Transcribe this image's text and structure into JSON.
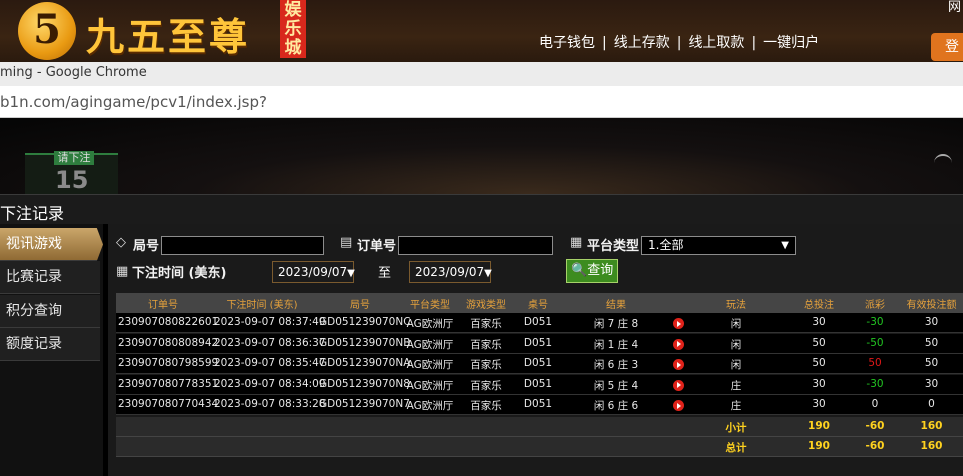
{
  "site": {
    "logo_digit": "5",
    "logo_text": "九五至尊",
    "logo_tag": "娱乐城",
    "nav": [
      "电子钱包",
      "线上存款",
      "线上取款",
      "一键归户"
    ],
    "top_right": "网",
    "action_button": "登"
  },
  "browser": {
    "window_title": "ming - Google Chrome",
    "url": "b1n.com/agingame/pcv1/index.jsp?"
  },
  "game": {
    "bet_label": "请下注",
    "countdown": "15"
  },
  "panel": {
    "title": "下注记录",
    "nav": [
      {
        "label": "视讯游戏",
        "active": true
      },
      {
        "label": "比赛记录",
        "active": false
      },
      {
        "label": "积分查询",
        "active": false
      },
      {
        "label": "额度记录",
        "active": false
      }
    ]
  },
  "filters": {
    "round_label": "局号",
    "round_value": "",
    "order_label": "订单号",
    "order_value": "",
    "platform_label": "平台类型",
    "platform_value": "1.全部",
    "time_label": "下注时间 (美东)",
    "date_from": "2023/09/07",
    "date_to": "2023/09/07",
    "to_text": "至",
    "search_label": "查询"
  },
  "table": {
    "headers": [
      "订单号",
      "下注时间 (美东)",
      "局号",
      "平台类型",
      "游戏类型",
      "桌号",
      "结果",
      "",
      "玩法",
      "总投注",
      "派彩",
      "有效投注额"
    ],
    "rows": [
      [
        "230907080822601",
        "2023-09-07 08:37:49",
        "GD051239070NC",
        "AG欧洲厅",
        "百家乐",
        "D051",
        "闲 7 庄 8",
        "闲",
        "30",
        "-30",
        "30"
      ],
      [
        "230907080808942",
        "2023-09-07 08:36:37",
        "GD051239070NB",
        "AG欧洲厅",
        "百家乐",
        "D051",
        "闲 1 庄 4",
        "闲",
        "50",
        "-50",
        "50"
      ],
      [
        "230907080798599",
        "2023-09-07 08:35:47",
        "GD051239070NA",
        "AG欧洲厅",
        "百家乐",
        "D051",
        "闲 6 庄 3",
        "闲",
        "50",
        "50",
        "50"
      ],
      [
        "230907080778351",
        "2023-09-07 08:34:09",
        "GD051239070N8",
        "AG欧洲厅",
        "百家乐",
        "D051",
        "闲 5 庄 4",
        "庄",
        "30",
        "-30",
        "30"
      ],
      [
        "230907080770434",
        "2023-09-07 08:33:28",
        "GD051239070N7",
        "AG欧洲厅",
        "百家乐",
        "D051",
        "闲 6 庄 6",
        "庄",
        "30",
        "0",
        "0"
      ]
    ],
    "payout_colors": [
      "#22c422",
      "#22c422",
      "#e01818",
      "#22c422",
      "#e8e8e8"
    ],
    "subtotal": {
      "label": "小计",
      "bet": "190",
      "payout": "-60",
      "valid": "160"
    },
    "total": {
      "label": "总计",
      "bet": "190",
      "payout": "-60",
      "valid": "160"
    }
  }
}
